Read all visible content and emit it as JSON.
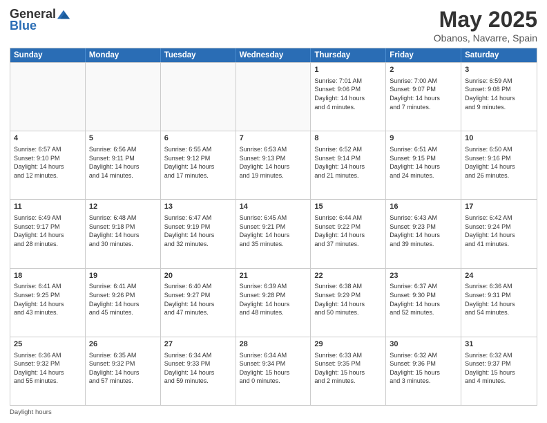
{
  "logo": {
    "general": "General",
    "blue": "Blue"
  },
  "title": "May 2025",
  "subtitle": "Obanos, Navarre, Spain",
  "days_of_week": [
    "Sunday",
    "Monday",
    "Tuesday",
    "Wednesday",
    "Thursday",
    "Friday",
    "Saturday"
  ],
  "weeks": [
    [
      {
        "day": "",
        "info": ""
      },
      {
        "day": "",
        "info": ""
      },
      {
        "day": "",
        "info": ""
      },
      {
        "day": "",
        "info": ""
      },
      {
        "day": "1",
        "info": "Sunrise: 7:01 AM\nSunset: 9:06 PM\nDaylight: 14 hours\nand 4 minutes."
      },
      {
        "day": "2",
        "info": "Sunrise: 7:00 AM\nSunset: 9:07 PM\nDaylight: 14 hours\nand 7 minutes."
      },
      {
        "day": "3",
        "info": "Sunrise: 6:59 AM\nSunset: 9:08 PM\nDaylight: 14 hours\nand 9 minutes."
      }
    ],
    [
      {
        "day": "4",
        "info": "Sunrise: 6:57 AM\nSunset: 9:10 PM\nDaylight: 14 hours\nand 12 minutes."
      },
      {
        "day": "5",
        "info": "Sunrise: 6:56 AM\nSunset: 9:11 PM\nDaylight: 14 hours\nand 14 minutes."
      },
      {
        "day": "6",
        "info": "Sunrise: 6:55 AM\nSunset: 9:12 PM\nDaylight: 14 hours\nand 17 minutes."
      },
      {
        "day": "7",
        "info": "Sunrise: 6:53 AM\nSunset: 9:13 PM\nDaylight: 14 hours\nand 19 minutes."
      },
      {
        "day": "8",
        "info": "Sunrise: 6:52 AM\nSunset: 9:14 PM\nDaylight: 14 hours\nand 21 minutes."
      },
      {
        "day": "9",
        "info": "Sunrise: 6:51 AM\nSunset: 9:15 PM\nDaylight: 14 hours\nand 24 minutes."
      },
      {
        "day": "10",
        "info": "Sunrise: 6:50 AM\nSunset: 9:16 PM\nDaylight: 14 hours\nand 26 minutes."
      }
    ],
    [
      {
        "day": "11",
        "info": "Sunrise: 6:49 AM\nSunset: 9:17 PM\nDaylight: 14 hours\nand 28 minutes."
      },
      {
        "day": "12",
        "info": "Sunrise: 6:48 AM\nSunset: 9:18 PM\nDaylight: 14 hours\nand 30 minutes."
      },
      {
        "day": "13",
        "info": "Sunrise: 6:47 AM\nSunset: 9:19 PM\nDaylight: 14 hours\nand 32 minutes."
      },
      {
        "day": "14",
        "info": "Sunrise: 6:45 AM\nSunset: 9:21 PM\nDaylight: 14 hours\nand 35 minutes."
      },
      {
        "day": "15",
        "info": "Sunrise: 6:44 AM\nSunset: 9:22 PM\nDaylight: 14 hours\nand 37 minutes."
      },
      {
        "day": "16",
        "info": "Sunrise: 6:43 AM\nSunset: 9:23 PM\nDaylight: 14 hours\nand 39 minutes."
      },
      {
        "day": "17",
        "info": "Sunrise: 6:42 AM\nSunset: 9:24 PM\nDaylight: 14 hours\nand 41 minutes."
      }
    ],
    [
      {
        "day": "18",
        "info": "Sunrise: 6:41 AM\nSunset: 9:25 PM\nDaylight: 14 hours\nand 43 minutes."
      },
      {
        "day": "19",
        "info": "Sunrise: 6:41 AM\nSunset: 9:26 PM\nDaylight: 14 hours\nand 45 minutes."
      },
      {
        "day": "20",
        "info": "Sunrise: 6:40 AM\nSunset: 9:27 PM\nDaylight: 14 hours\nand 47 minutes."
      },
      {
        "day": "21",
        "info": "Sunrise: 6:39 AM\nSunset: 9:28 PM\nDaylight: 14 hours\nand 48 minutes."
      },
      {
        "day": "22",
        "info": "Sunrise: 6:38 AM\nSunset: 9:29 PM\nDaylight: 14 hours\nand 50 minutes."
      },
      {
        "day": "23",
        "info": "Sunrise: 6:37 AM\nSunset: 9:30 PM\nDaylight: 14 hours\nand 52 minutes."
      },
      {
        "day": "24",
        "info": "Sunrise: 6:36 AM\nSunset: 9:31 PM\nDaylight: 14 hours\nand 54 minutes."
      }
    ],
    [
      {
        "day": "25",
        "info": "Sunrise: 6:36 AM\nSunset: 9:32 PM\nDaylight: 14 hours\nand 55 minutes."
      },
      {
        "day": "26",
        "info": "Sunrise: 6:35 AM\nSunset: 9:32 PM\nDaylight: 14 hours\nand 57 minutes."
      },
      {
        "day": "27",
        "info": "Sunrise: 6:34 AM\nSunset: 9:33 PM\nDaylight: 14 hours\nand 59 minutes."
      },
      {
        "day": "28",
        "info": "Sunrise: 6:34 AM\nSunset: 9:34 PM\nDaylight: 15 hours\nand 0 minutes."
      },
      {
        "day": "29",
        "info": "Sunrise: 6:33 AM\nSunset: 9:35 PM\nDaylight: 15 hours\nand 2 minutes."
      },
      {
        "day": "30",
        "info": "Sunrise: 6:32 AM\nSunset: 9:36 PM\nDaylight: 15 hours\nand 3 minutes."
      },
      {
        "day": "31",
        "info": "Sunrise: 6:32 AM\nSunset: 9:37 PM\nDaylight: 15 hours\nand 4 minutes."
      }
    ]
  ],
  "footer": "Daylight hours"
}
